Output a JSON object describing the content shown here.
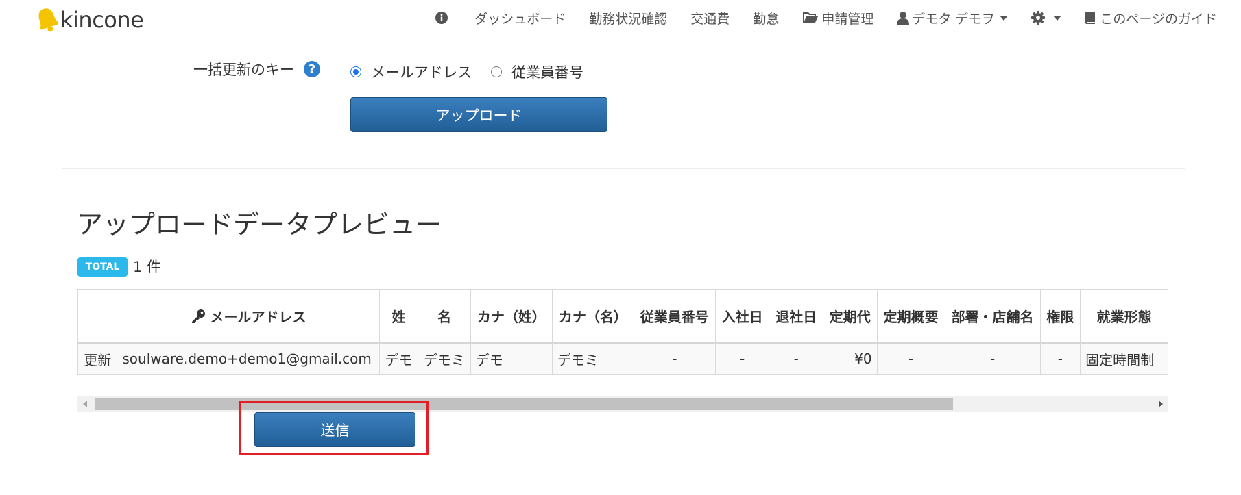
{
  "brand": {
    "name": "kincone",
    "logo_color": "#f5c400"
  },
  "nav": {
    "items": [
      {
        "label": "",
        "icon": "info-circle-icon"
      },
      {
        "label": "ダッシュボード"
      },
      {
        "label": "勤務状況確認"
      },
      {
        "label": "交通費"
      },
      {
        "label": "勤怠"
      },
      {
        "label": "申請管理",
        "icon": "folder-open-icon"
      },
      {
        "label": "デモタ デモヲ",
        "icon": "user-icon",
        "dropdown": true
      },
      {
        "label": "",
        "icon": "gear-icon",
        "dropdown": true
      },
      {
        "label": "このページのガイド",
        "icon": "book-icon"
      }
    ]
  },
  "form": {
    "key_label": "一括更新のキー",
    "help_glyph": "?",
    "options": [
      {
        "label": "メールアドレス",
        "checked": true
      },
      {
        "label": "従業員番号",
        "checked": false
      }
    ],
    "upload_button": "アップロード"
  },
  "preview": {
    "title": "アップロードデータプレビュー",
    "total_badge": "TOTAL",
    "total_count": "1 件",
    "columns": [
      "",
      "メールアドレス",
      "姓",
      "名",
      "カナ（姓）",
      "カナ（名）",
      "従業員番号",
      "入社日",
      "退社日",
      "定期代",
      "定期概要",
      "部署・店舗名",
      "権限",
      "就業形態"
    ],
    "rows": [
      [
        "更新",
        "soulware.demo+demo1@gmail.com",
        "デモ",
        "デモミ",
        "デモ",
        "デモミ",
        "-",
        "-",
        "-",
        "¥0",
        "-",
        "-",
        "-",
        "固定時間制"
      ]
    ]
  },
  "submit_button": "送信",
  "colors": {
    "accent": "#2a6aa8",
    "badge": "#2bb8ea",
    "highlight": "#e31e24"
  }
}
